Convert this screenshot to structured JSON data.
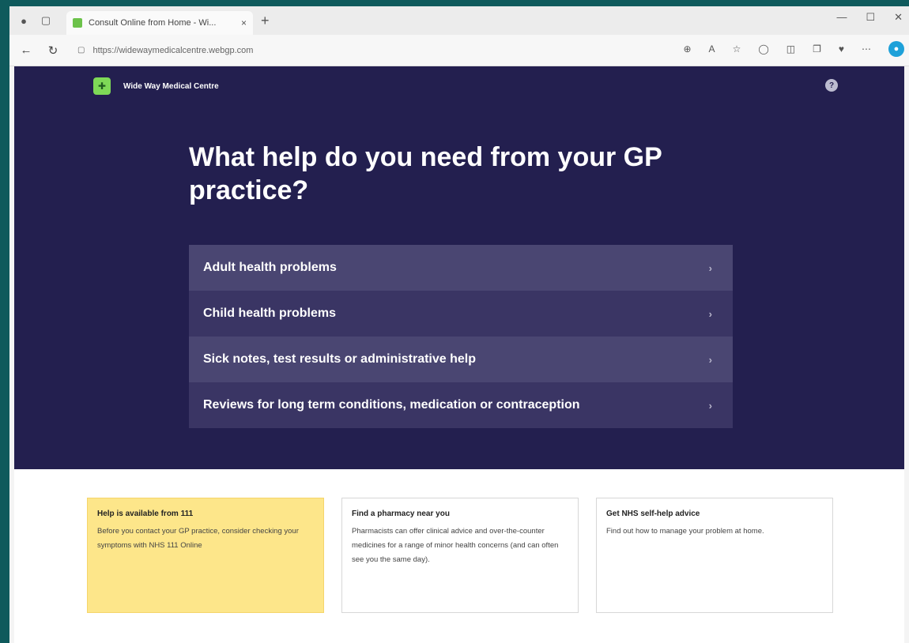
{
  "browser": {
    "tab_title": "Consult Online from Home - Wi...",
    "tab_close": "×",
    "new_tab": "+",
    "url": "https://widewaymedicalcentre.webgp.com",
    "controls": {
      "minimize": "—",
      "maximize": "☐",
      "close": "✕"
    }
  },
  "site": {
    "name": "Wide Way Medical Centre",
    "help_icon": "?"
  },
  "hero": {
    "heading": "What help do you need from your GP practice?",
    "options": [
      {
        "label": "Adult health problems"
      },
      {
        "label": "Child health problems"
      },
      {
        "label": "Sick notes, test results or administrative help"
      },
      {
        "label": "Reviews for long term conditions, medication or contraception"
      }
    ],
    "chevron": "›"
  },
  "cards": [
    {
      "title": "Help is available from 111",
      "body": "Before you contact your GP practice, consider checking your symptoms with NHS 111 Online"
    },
    {
      "title": "Find a pharmacy near you",
      "body": "Pharmacists can offer clinical advice and over-the-counter medicines for a range of minor health concerns (and can often see you the same day)."
    },
    {
      "title": "Get NHS self-help advice",
      "body": "Find out how to manage your problem at home."
    }
  ],
  "colors": {
    "hero_bg": "#231f4f",
    "option_light": "#4a4672",
    "option_dark": "#3a3564",
    "card_yellow": "#fde68a",
    "logo_green": "#7ed957"
  }
}
